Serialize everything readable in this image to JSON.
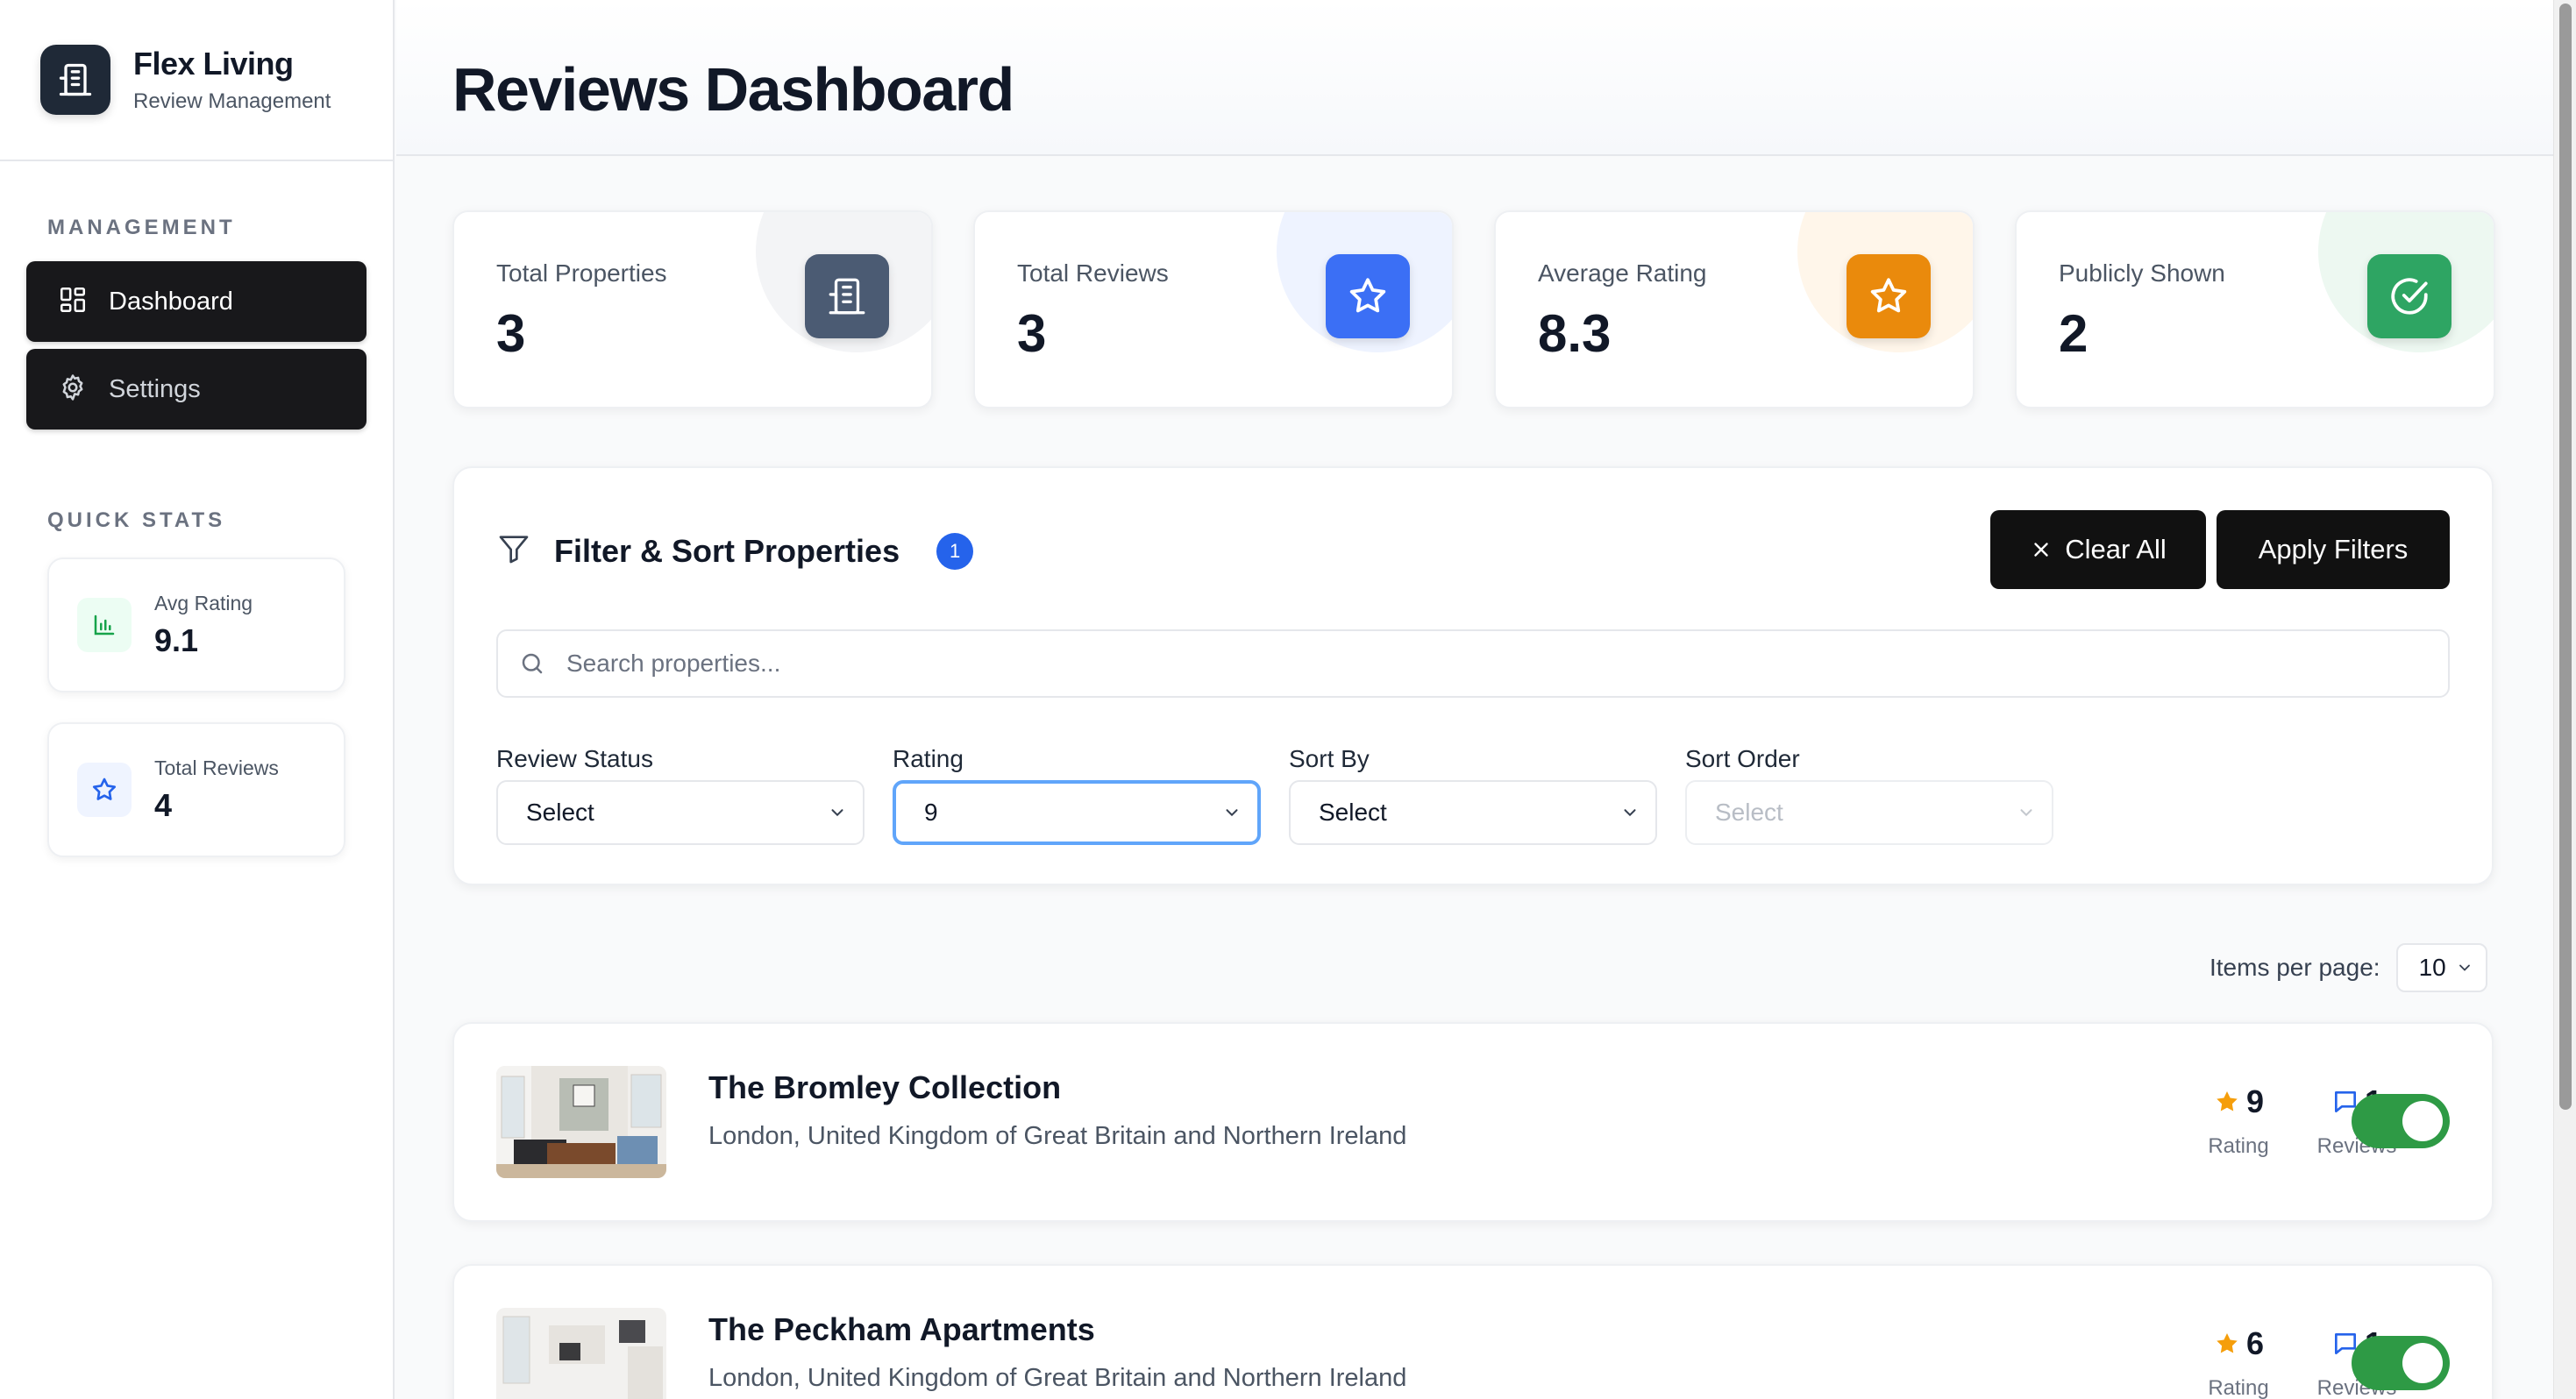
{
  "brand": {
    "name": "Flex Living",
    "subtitle": "Review Management"
  },
  "sidebar": {
    "management_title": "MANAGEMENT",
    "nav": [
      {
        "label": "Dashboard",
        "icon": "grid-icon"
      },
      {
        "label": "Settings",
        "icon": "gear-icon"
      }
    ],
    "quick_stats_title": "QUICK STATS",
    "quick_stats": [
      {
        "label": "Avg Rating",
        "value": "9.1",
        "icon": "bar-chart-icon",
        "color": "#16a34a"
      },
      {
        "label": "Total Reviews",
        "value": "4",
        "icon": "star-icon",
        "color": "#2563eb"
      }
    ]
  },
  "page": {
    "title": "Reviews Dashboard"
  },
  "stats": [
    {
      "label": "Total Properties",
      "value": "3",
      "icon": "building-icon",
      "color": "#475569"
    },
    {
      "label": "Total Reviews",
      "value": "3",
      "icon": "star-icon",
      "color": "#2563eb"
    },
    {
      "label": "Average Rating",
      "value": "8.3",
      "icon": "star-icon",
      "color": "#f59e0b"
    },
    {
      "label": "Publicly Shown",
      "value": "2",
      "icon": "check-circle-icon",
      "color": "#16a34a"
    }
  ],
  "filters": {
    "title": "Filter & Sort Properties",
    "active_count": "1",
    "clear_label": "Clear All",
    "apply_label": "Apply Filters",
    "search_placeholder": "Search properties...",
    "fields": [
      {
        "label": "Review Status",
        "value": "Select"
      },
      {
        "label": "Rating",
        "value": "9"
      },
      {
        "label": "Sort By",
        "value": "Select"
      },
      {
        "label": "Sort Order",
        "value": "Select"
      }
    ]
  },
  "pagination": {
    "items_per_page_label": "Items per page:",
    "items_per_page": "10"
  },
  "properties": [
    {
      "name": "The Bromley Collection",
      "location": "London, United Kingdom of Great Britain and Northern Ireland",
      "rating": "9",
      "rating_label": "Rating",
      "reviews": "1",
      "reviews_label": "Reviews",
      "public": true
    },
    {
      "name": "The Peckham Apartments",
      "location": "London, United Kingdom of Great Britain and Northern Ireland",
      "rating": "6",
      "rating_label": "Rating",
      "reviews": "1",
      "reviews_label": "Reviews",
      "public": true
    }
  ]
}
